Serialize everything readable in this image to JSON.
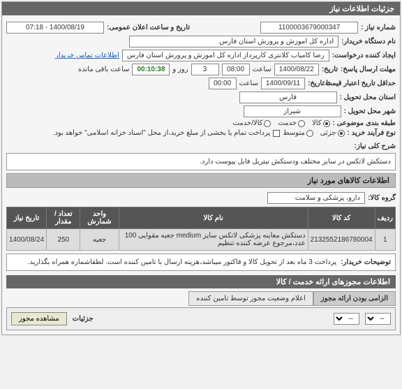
{
  "panel1": {
    "title": "جزئیات اطلاعات نیاز",
    "need_no_label": "شماره نیاز :",
    "need_no": "1100003679000347",
    "public_datetime_label": "تاریخ و ساعت اعلان عمومی:",
    "public_datetime": "1400/08/19 - 07:18",
    "buyer_label": "نام دستگاه خریدار:",
    "buyer": "اداره کل اموزش و پرورش استان فارس",
    "creator_label": "ایجاد کننده درخواست:",
    "creator": "رضا کامیاب کلانتری کارپرداز اداره کل اموزش و پرورش استان فارس",
    "contact_link": "اطلاعات تماس خریدار",
    "reply_deadline_label": "مهلت ارسال پاسخ:",
    "reply_deadline_date_label": "تاریخ:",
    "reply_deadline_date": "1400/08/22",
    "time_label": "ساعت",
    "reply_deadline_time": "08:00",
    "days_label": "روز و",
    "days": "3",
    "remaining_label": "ساعت باقی مانده",
    "remaining": "00:10:38",
    "validity_label": "حداقل تاریخ اعتبار قیمت:",
    "validity_until_label": "تا تاریخ:",
    "validity_date": "1400/09/11",
    "validity_time": "00:00",
    "province_label": "استان محل تحویل :",
    "province": "فارس",
    "city_label": "شهر محل تحویل :",
    "city": "شیراز",
    "category_label": "طبقه بندی موضوعی :",
    "cat_goods": "کالا",
    "cat_service": "خدمت",
    "cat_goods_service": "کالا/خدمت",
    "purchase_type_label": "نوع فرآیند خرید :",
    "pt_partial": "جزئی",
    "pt_medium": "متوسط",
    "pt_note": "پرداخت تمام یا بخشی از مبلغ خرید،از محل \"اسناد خزانه اسلامی\" خواهد بود.",
    "desc_label": "شرح کلی نیاز:",
    "desc": "دستکش لاتکس در سایز مختلف ودستکش نیتریل فایل پیوست دارد."
  },
  "panel2": {
    "title": "اطلاعات کالاهای مورد نیاز",
    "group_label": "گروه کالا:",
    "group": "دارو، پزشکی و سلامت",
    "table": {
      "headers": [
        "ردیف",
        "کد کالا",
        "نام کالا",
        "واحد شمارش",
        "تعداد / مقدار",
        "تاریخ نیاز"
      ],
      "rows": [
        {
          "idx": "1",
          "code": "2132552186780004",
          "name": "دستکش معاینه پزشکی لاتکس سایز medium جعبه مقوایی 100 عدد،مرجوع عرضه کننده تنظیم",
          "unit": "جعبه",
          "qty": "250",
          "date": "1400/08/24"
        }
      ]
    },
    "buyer_note_label": "توضیحات خریدار:",
    "buyer_note": "پرداخت 3 ماه بعد از تحویل کالا و فاکتور میباشد،هزینه ارسال با تامین کننده است.  لطفاشماره همراه بگذارید."
  },
  "panel3": {
    "title": "اطلاعات مجوزهای ارائه خدمت / کالا",
    "tab1": "الزامی بودن ارائه مجوز",
    "tab2": "اعلام وضعیت مجوز توسط تامین کننده",
    "select_placeholder": "--",
    "details_btn": "جزئیات",
    "view_btn": "مشاهده مجوز"
  }
}
